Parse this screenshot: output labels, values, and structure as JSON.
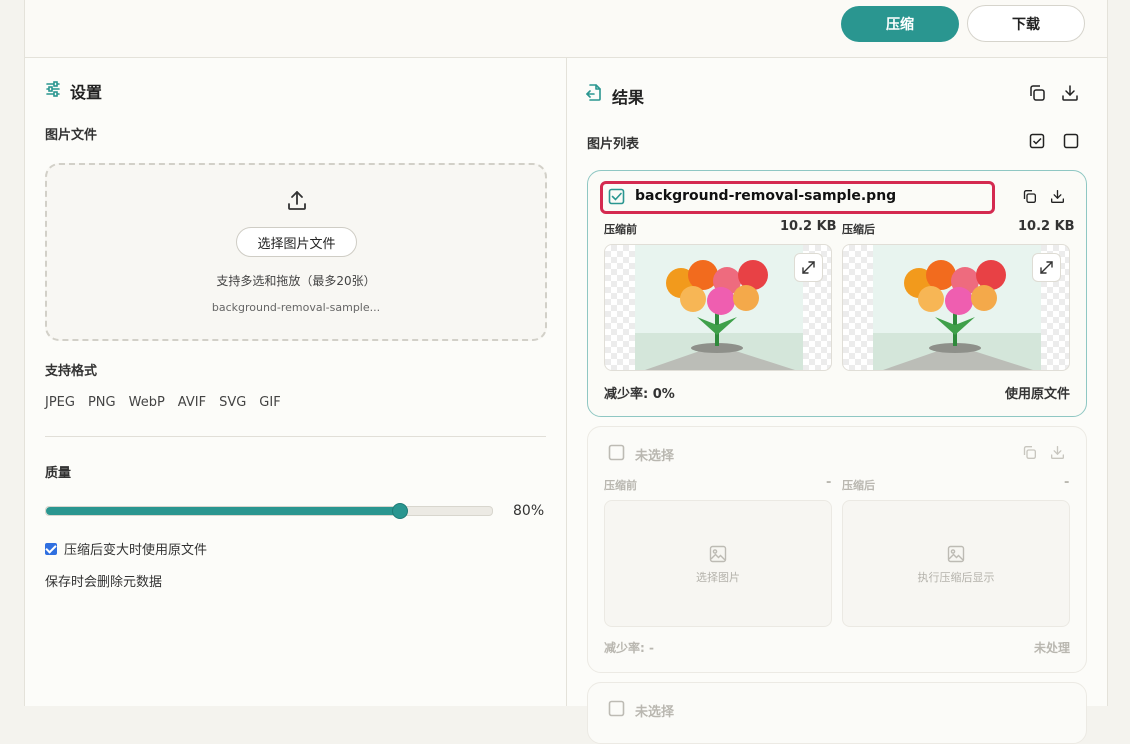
{
  "toolbar": {
    "compress_label": "压缩",
    "download_label": "下载"
  },
  "settings": {
    "title": "设置",
    "image_file_label": "图片文件",
    "pick_button": "选择图片文件",
    "dropzone_hint": "支持多选和拖放（最多20张）",
    "dropzone_filename": "background-removal-sample...",
    "formats_label": "支持格式",
    "formats": [
      "JPEG",
      "PNG",
      "WebP",
      "AVIF",
      "SVG",
      "GIF"
    ],
    "quality_label": "质量",
    "quality_value": 80,
    "quality_text": "80%",
    "use_original_label": "压缩后变大时使用原文件",
    "use_original_checked": true,
    "metadata_note": "保存时会删除元数据"
  },
  "results": {
    "title": "结果",
    "list_label": "图片列表",
    "cards": [
      {
        "checked": true,
        "filename": "background-removal-sample.png",
        "before_label": "压缩前",
        "before_size": "10.2 KB",
        "after_label": "压缩后",
        "after_size": "10.2 KB",
        "reduction": "减少率: 0%",
        "status": "使用原文件"
      },
      {
        "checked": false,
        "filename": "未选择",
        "before_label": "压缩前",
        "before_size": "-",
        "after_label": "压缩后",
        "after_size": "-",
        "before_placeholder": "选择图片",
        "after_placeholder": "执行压缩后显示",
        "reduction": "减少率: -",
        "status": "未处理"
      },
      {
        "checked": false,
        "filename": "未选择"
      }
    ]
  },
  "colors": {
    "accent": "#2a9690",
    "highlight": "#d42a50",
    "checkbox": "#2f6fe0"
  }
}
